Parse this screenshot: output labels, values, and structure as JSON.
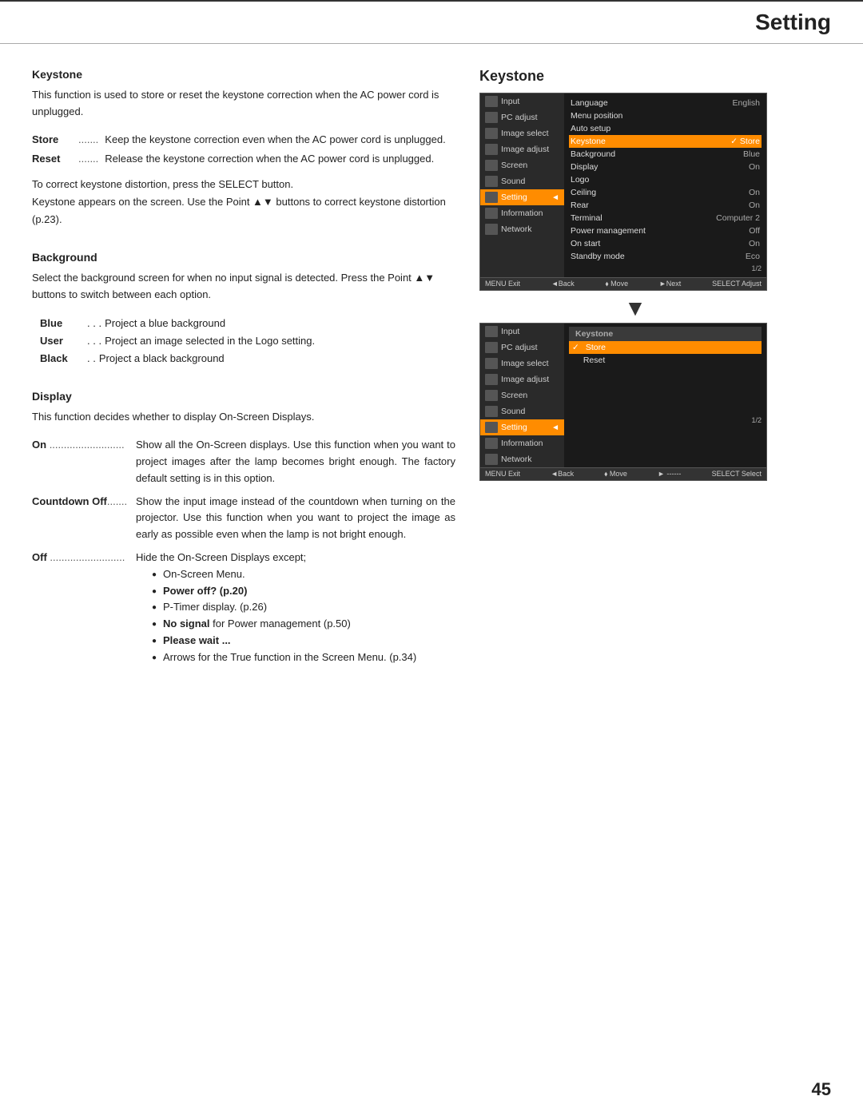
{
  "header": {
    "title": "Setting"
  },
  "footer": {
    "page_number": "45"
  },
  "left": {
    "keystone_section": {
      "title": "Keystone",
      "body": "This function is used to store or reset the keystone correction when the AC power cord is unplugged.",
      "store_label": "Store",
      "store_dots": ".......",
      "store_text": "Keep the keystone correction even when the AC power cord is unplugged.",
      "reset_label": "Reset",
      "reset_dots": ".......",
      "reset_text": "Release the keystone correction when the AC power cord is unplugged.",
      "note": "To correct keystone distortion, press the SELECT button.",
      "note2": "Keystone appears on the screen. Use the Point ▲▼ buttons to correct keystone distortion (p.23)."
    },
    "background_section": {
      "title": "Background",
      "body": "Select the background screen for when no input signal is detected. Press the Point ▲▼ buttons to switch between each option.",
      "blue_label": "Blue",
      "blue_dots": ". . .",
      "blue_text": "Project a blue background",
      "user_label": "User",
      "user_dots": ". . .",
      "user_text": "Project an image selected in the Logo setting.",
      "black_label": "Black",
      "black_dots": ". .",
      "black_text": "Project a black background"
    },
    "display_section": {
      "title": "Display",
      "body": "This function decides whether to display On-Screen Displays.",
      "on_label": "On",
      "on_dots": "......................",
      "on_text": "Show all the On-Screen displays. Use this function when you want to project images after the lamp becomes bright enough. The factory default setting is in this option.",
      "countdown_label": "Countdown Off",
      "countdown_dots": ".......",
      "countdown_text": "Show the input image instead of the countdown when turning on the projector. Use this function when you want to project the image as early as possible even when the lamp is not bright enough.",
      "off_label": "Off",
      "off_dots": "......................",
      "off_text": "Hide the On-Screen Displays except;",
      "bullet_items": [
        "On-Screen Menu.",
        "Power off? (p.20)",
        "P-Timer display. (p.26)",
        "No signal for Power management (p.50)",
        "Please wait ...",
        "Arrows for the True function in the Screen Menu. (p.34)"
      ],
      "bullet_bold": [
        false,
        true,
        false,
        true,
        true,
        false
      ]
    }
  },
  "right": {
    "keystone_title": "Keystone",
    "menu1": {
      "left_items": [
        {
          "icon": "input-icon",
          "label": "Input",
          "active": false
        },
        {
          "icon": "pc-icon",
          "label": "PC adjust",
          "active": false
        },
        {
          "icon": "image-select-icon",
          "label": "Image select",
          "active": false
        },
        {
          "icon": "image-adjust-icon",
          "label": "Image adjust",
          "active": false
        },
        {
          "icon": "screen-icon",
          "label": "Screen",
          "active": false
        },
        {
          "icon": "sound-icon",
          "label": "Sound",
          "active": false
        },
        {
          "icon": "setting-icon",
          "label": "Setting",
          "active": true
        },
        {
          "icon": "information-icon",
          "label": "Information",
          "active": false
        },
        {
          "icon": "network-icon",
          "label": "Network",
          "active": false
        }
      ],
      "right_header": "1/2",
      "right_items": [
        {
          "label": "Language",
          "value": "English",
          "highlighted": false
        },
        {
          "label": "Menu position",
          "value": "",
          "highlighted": false
        },
        {
          "label": "Auto setup",
          "value": "",
          "highlighted": false
        },
        {
          "label": "Keystone",
          "value": "✓ Store",
          "highlighted": true
        },
        {
          "label": "Background",
          "value": "Blue",
          "highlighted": false
        },
        {
          "label": "Display",
          "value": "On",
          "highlighted": false
        },
        {
          "label": "Logo",
          "value": "",
          "highlighted": false
        },
        {
          "label": "Ceiling",
          "value": "On",
          "highlighted": false
        },
        {
          "label": "Rear",
          "value": "On",
          "highlighted": false
        },
        {
          "label": "Terminal",
          "value": "Computer 2",
          "highlighted": false
        },
        {
          "label": "Power management",
          "value": "Off",
          "highlighted": false
        },
        {
          "label": "On start",
          "value": "On",
          "highlighted": false
        },
        {
          "label": "Standby mode",
          "value": "Eco",
          "highlighted": false
        }
      ],
      "statusbar": {
        "exit": "MENU Exit",
        "back": "◄Back",
        "move": "⬧ Move",
        "next": "► Next",
        "adjust": "SELECT Adjust"
      }
    },
    "menu2": {
      "left_items": [
        {
          "icon": "input-icon",
          "label": "Input",
          "active": false
        },
        {
          "icon": "pc-icon",
          "label": "PC adjust",
          "active": false
        },
        {
          "icon": "image-select-icon",
          "label": "Image select",
          "active": false
        },
        {
          "icon": "image-adjust-icon",
          "label": "Image adjust",
          "active": false
        },
        {
          "icon": "screen-icon",
          "label": "Screen",
          "active": false
        },
        {
          "icon": "sound-icon",
          "label": "Sound",
          "active": false
        },
        {
          "icon": "setting-icon",
          "label": "Setting",
          "active": true
        },
        {
          "icon": "information-icon",
          "label": "Information",
          "active": false
        },
        {
          "icon": "network-icon",
          "label": "Network",
          "active": false
        }
      ],
      "right_header_label": "Keystone",
      "right_items": [
        {
          "label": "✓ Store",
          "highlighted": true
        },
        {
          "label": "Reset",
          "highlighted": false
        }
      ],
      "page_num": "1/2",
      "statusbar": {
        "exit": "MENU Exit",
        "back": "◄Back",
        "move": "⬧ Move",
        "next": "► ------",
        "adjust": "SELECT Select"
      }
    }
  }
}
